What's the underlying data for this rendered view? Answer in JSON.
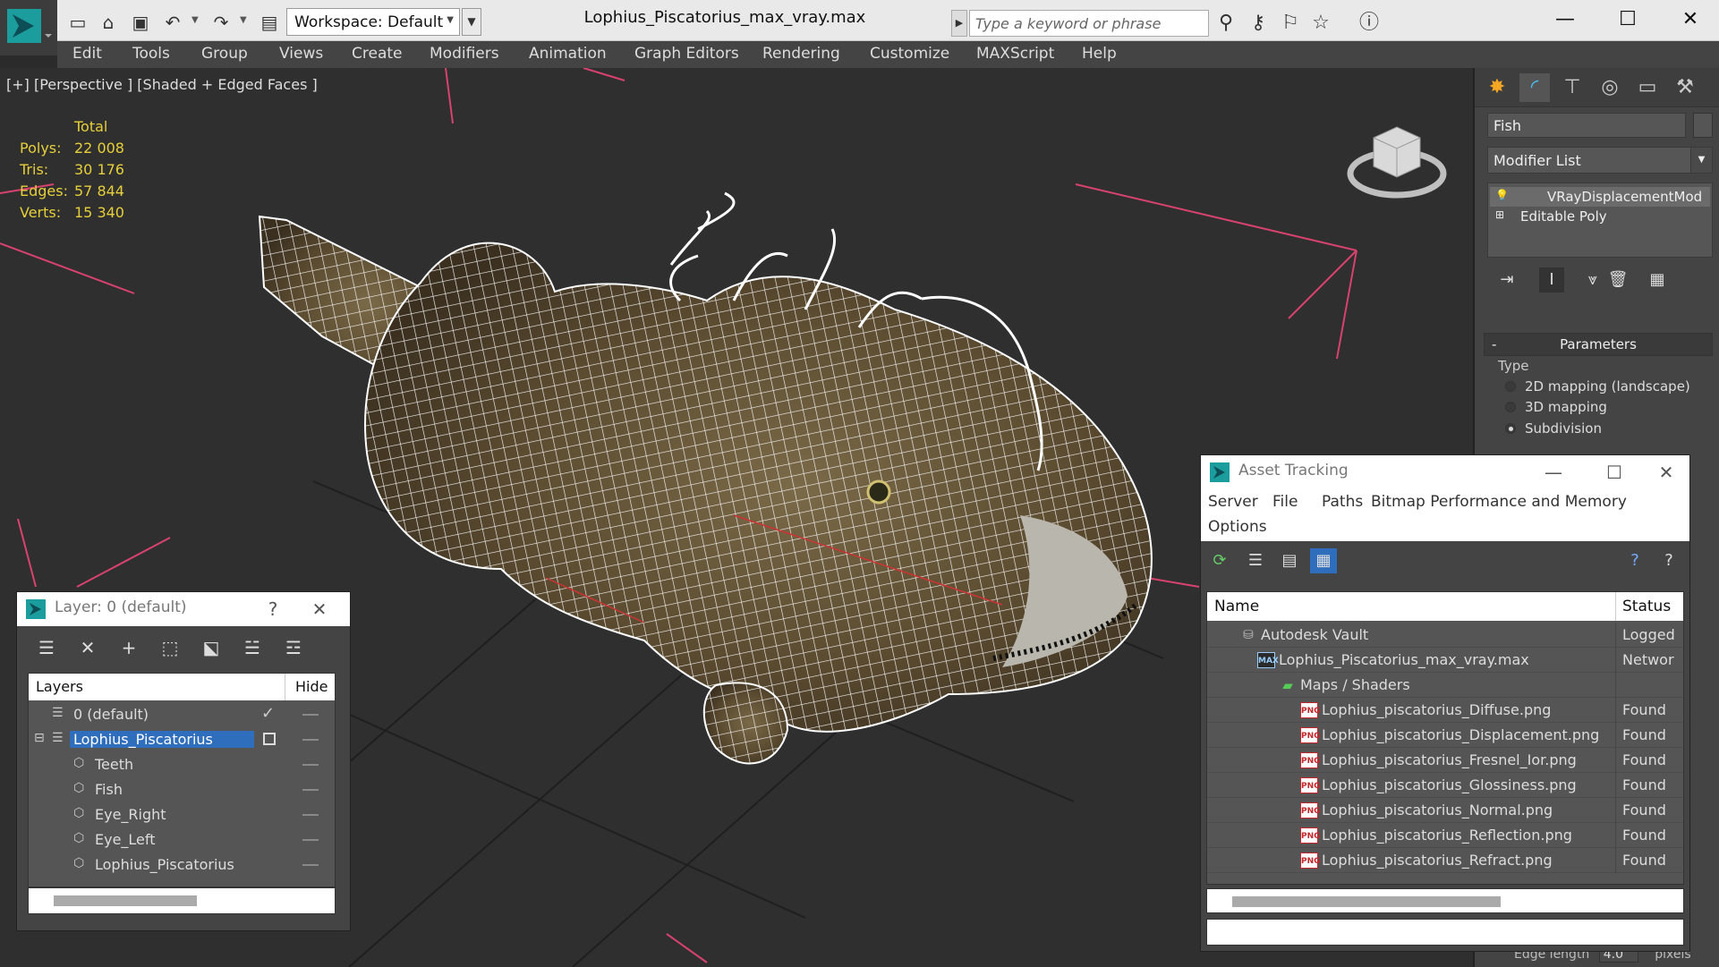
{
  "app": {
    "document_title": "Lophius_Piscatorius_max_vray.max",
    "workspace_label": "Workspace: Default",
    "search_placeholder": "Type a keyword or phrase"
  },
  "menu": [
    "Edit",
    "Tools",
    "Group",
    "Views",
    "Create",
    "Modifiers",
    "Animation",
    "Graph Editors",
    "Rendering",
    "Customize",
    "MAXScript",
    "Help"
  ],
  "viewport": {
    "label": "[+] [Perspective ] [Shaded + Edged Faces ]",
    "stats_header": "Total",
    "stats": [
      {
        "key": "Polys:",
        "value": "22 008"
      },
      {
        "key": "Tris:",
        "value": "30 176"
      },
      {
        "key": "Edges:",
        "value": "57 844"
      },
      {
        "key": "Verts:",
        "value": "15 340"
      }
    ]
  },
  "command_panel": {
    "object_name": "Fish",
    "modifier_list": "Modifier List",
    "stack": [
      "VRayDisplacementMod",
      "Editable Poly"
    ],
    "rollout_title": "Parameters",
    "type_label": "Type",
    "type_options": [
      {
        "label": "2D mapping (landscape)",
        "selected": false
      },
      {
        "label": "3D mapping",
        "selected": false
      },
      {
        "label": "Subdivision",
        "selected": true
      }
    ],
    "edge_length_label": "Edge length",
    "edge_length_value": "4.0",
    "edge_length_unit": "pixels"
  },
  "layer_dialog": {
    "title": "Layer: 0 (default)",
    "help": "?",
    "col_layers": "Layers",
    "col_hide": "Hide",
    "rows": [
      {
        "label": "0 (default)",
        "level": 1,
        "type": "layer",
        "active": true
      },
      {
        "label": "Lophius_Piscatorius",
        "level": 1,
        "type": "layer",
        "selected": true
      },
      {
        "label": "Teeth",
        "level": 2,
        "type": "object"
      },
      {
        "label": "Fish",
        "level": 2,
        "type": "object"
      },
      {
        "label": "Eye_Right",
        "level": 2,
        "type": "object"
      },
      {
        "label": "Eye_Left",
        "level": 2,
        "type": "object"
      },
      {
        "label": "Lophius_Piscatorius",
        "level": 2,
        "type": "object"
      }
    ]
  },
  "asset_dialog": {
    "title": "Asset Tracking",
    "menu": [
      "Server",
      "File",
      "Paths",
      "Bitmap Performance and Memory",
      "Options"
    ],
    "col_name": "Name",
    "col_status": "Status",
    "rows": [
      {
        "name": "Autodesk Vault",
        "status": "Logged",
        "level": 1,
        "icon": "vault"
      },
      {
        "name": "Lophius_Piscatorius_max_vray.max",
        "status": "Networ",
        "level": 2,
        "icon": "max"
      },
      {
        "name": "Maps / Shaders",
        "status": "",
        "level": 3,
        "icon": "folder"
      },
      {
        "name": "Lophius_piscatorius_Diffuse.png",
        "status": "Found",
        "level": 4,
        "icon": "png"
      },
      {
        "name": "Lophius_piscatorius_Displacement.png",
        "status": "Found",
        "level": 4,
        "icon": "png"
      },
      {
        "name": "Lophius_piscatorius_Fresnel_Ior.png",
        "status": "Found",
        "level": 4,
        "icon": "png"
      },
      {
        "name": "Lophius_piscatorius_Glossiness.png",
        "status": "Found",
        "level": 4,
        "icon": "png"
      },
      {
        "name": "Lophius_piscatorius_Normal.png",
        "status": "Found",
        "level": 4,
        "icon": "png"
      },
      {
        "name": "Lophius_piscatorius_Reflection.png",
        "status": "Found",
        "level": 4,
        "icon": "png"
      },
      {
        "name": "Lophius_piscatorius_Refract.png",
        "status": "Found",
        "level": 4,
        "icon": "png"
      }
    ]
  },
  "colors": {
    "stats_text": "#e6cf3a",
    "selection": "#2f6dbd",
    "wire": "#ffffff",
    "body_fill": "#6b5a3c",
    "grid_line": "#1e1e1e",
    "guide_line": "#d8426f"
  }
}
